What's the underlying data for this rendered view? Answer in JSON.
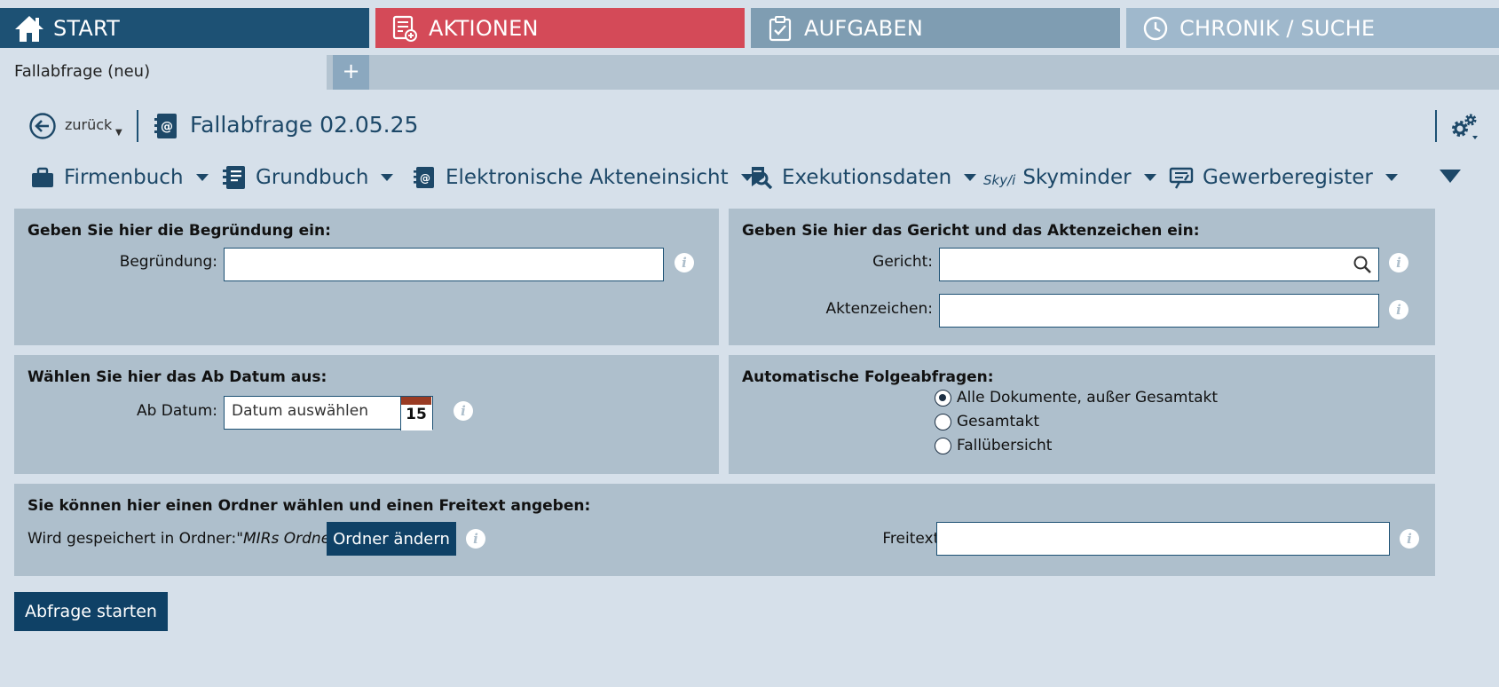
{
  "topnav": {
    "start": "START",
    "aktionen": "AKTIONEN",
    "aufgaben": "AUFGABEN",
    "chronik": "CHRONIK / SUCHE"
  },
  "tabs": {
    "active": "Fallabfrage (neu)",
    "add": "+"
  },
  "header": {
    "back_label": "zurück",
    "title": "Fallabfrage 02.05.25"
  },
  "toolbar": {
    "firmenbuch": "Firmenbuch",
    "grundbuch": "Grundbuch",
    "akteneinsicht": "Elektronische Akteneinsicht",
    "exekution": "Exekutionsdaten",
    "skyminder_logo": "Sky/i",
    "skyminder": "Skyminder",
    "gewerbe": "Gewerberegister"
  },
  "begruendung": {
    "title": "Geben Sie hier die Begründung ein:",
    "label": "Begründung:",
    "value": ""
  },
  "gericht": {
    "title": "Geben Sie hier das Gericht und das Aktenzeichen ein:",
    "gericht_label": "Gericht:",
    "gericht_value": "",
    "akten_label": "Aktenzeichen:",
    "akten_value": ""
  },
  "datum": {
    "title": "Wählen Sie hier das Ab Datum aus:",
    "label": "Ab Datum:",
    "placeholder": "Datum auswählen",
    "cal_day": "15"
  },
  "folge": {
    "title": "Automatische Folgeabfragen:",
    "options": [
      "Alle Dokumente, außer Gesamtakt",
      "Gesamtakt",
      "Fallübersicht"
    ],
    "selected": 0
  },
  "ordner": {
    "title": "Sie können hier einen Ordner wählen und einen Freitext angeben:",
    "saved_prefix": "Wird gespeichert in Ordner:",
    "folder_name": "\"MIRs Ordner\"",
    "change_button": "Ordner ändern",
    "freitext_label": "Freitext:",
    "freitext_value": ""
  },
  "submit": "Abfrage starten",
  "info_glyph": "i",
  "colors": {
    "navy": "#1d5174",
    "red": "#d44a58",
    "panel": "#aebfcc",
    "background": "#d6e0ea"
  }
}
